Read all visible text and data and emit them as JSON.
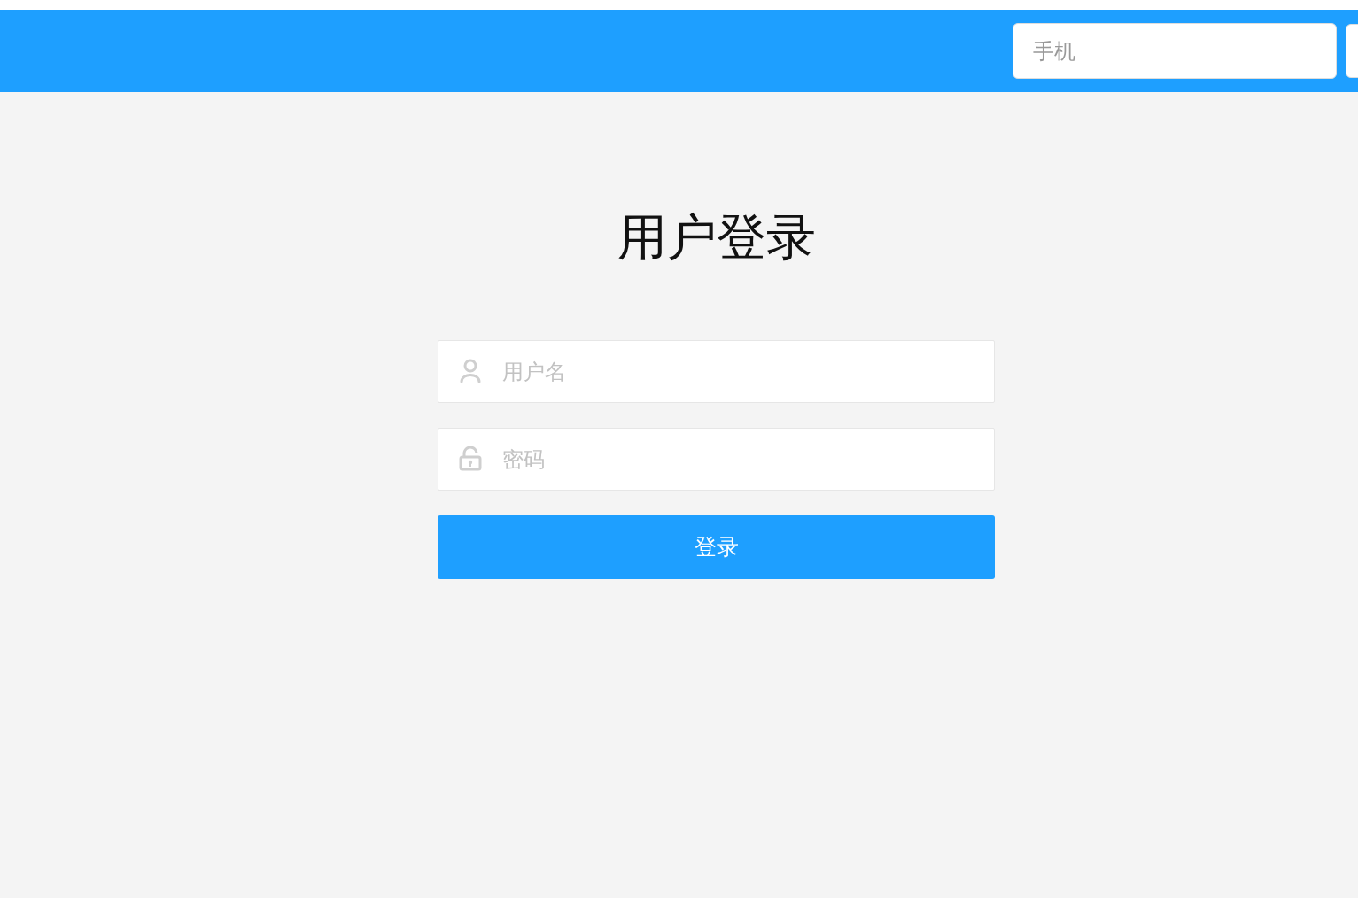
{
  "header": {
    "phone_field": {
      "placeholder": "手机"
    }
  },
  "login": {
    "title": "用户登录",
    "fields": [
      {
        "kind": "user",
        "placeholder": "用户名"
      },
      {
        "kind": "lock",
        "placeholder": "密码"
      }
    ],
    "button": "登录"
  }
}
